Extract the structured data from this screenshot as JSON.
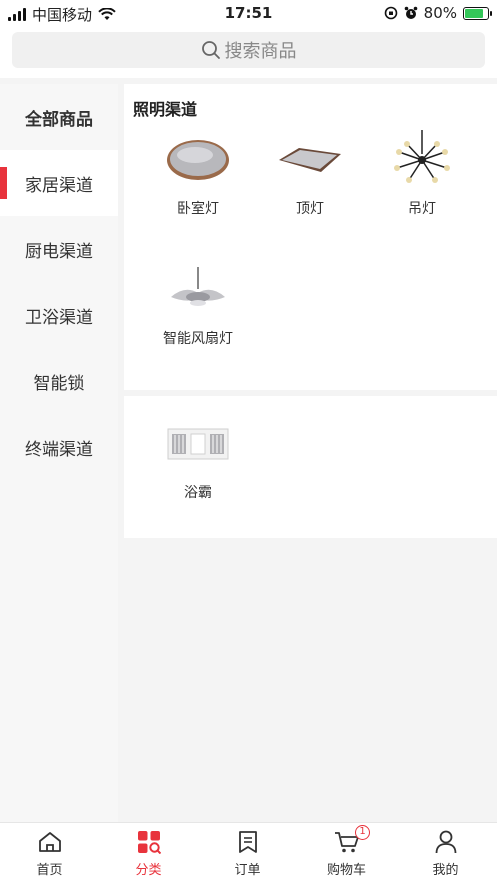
{
  "status_bar": {
    "carrier": "中国移动",
    "time": "17:51",
    "battery": "80%",
    "battery_level": 0.8
  },
  "search": {
    "placeholder": "搜索商品"
  },
  "sidebar": {
    "items": [
      {
        "label": "全部商品"
      },
      {
        "label": "家居渠道"
      },
      {
        "label": "厨电渠道"
      },
      {
        "label": "卫浴渠道"
      },
      {
        "label": "智能锁"
      },
      {
        "label": "终端渠道"
      }
    ]
  },
  "content": {
    "section1": {
      "title": "照明渠道",
      "products": [
        {
          "label": "卧室灯",
          "icon": "ceiling-round-lamp-icon"
        },
        {
          "label": "顶灯",
          "icon": "ceiling-square-lamp-icon"
        },
        {
          "label": "吊灯",
          "icon": "chandelier-icon"
        },
        {
          "label": "智能风扇灯",
          "icon": "fan-lamp-icon"
        }
      ]
    },
    "section2": {
      "products": [
        {
          "label": "浴霸",
          "icon": "bath-heater-icon"
        }
      ]
    }
  },
  "tabbar": {
    "tabs": [
      {
        "label": "首页",
        "icon": "home-icon"
      },
      {
        "label": "分类",
        "icon": "category-icon"
      },
      {
        "label": "订单",
        "icon": "order-icon"
      },
      {
        "label": "购物车",
        "icon": "cart-icon",
        "badge": "1"
      },
      {
        "label": "我的",
        "icon": "user-icon"
      }
    ]
  },
  "colors": {
    "accent": "#e8333c",
    "battery_green": "#34c759"
  }
}
